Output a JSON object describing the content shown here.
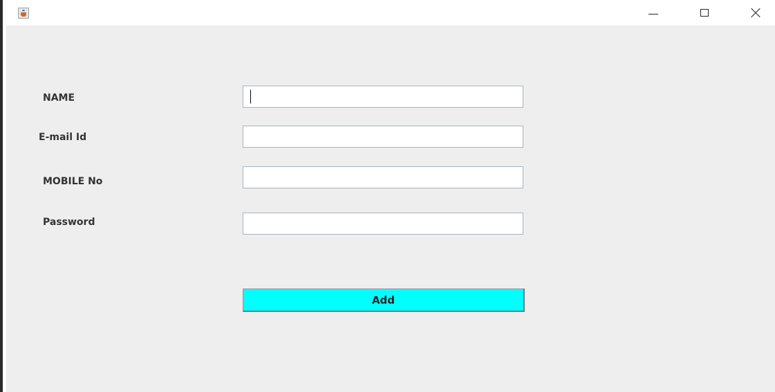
{
  "window": {
    "title": "",
    "app_icon": "java-cup-icon",
    "controls": {
      "minimize": "minimize-icon",
      "maximize": "maximize-icon",
      "close": "close-icon"
    }
  },
  "form": {
    "fields": [
      {
        "label": "NAME",
        "value": "",
        "placeholder": ""
      },
      {
        "label": "E-mail Id",
        "value": "",
        "placeholder": ""
      },
      {
        "label": "MOBILE No",
        "value": "",
        "placeholder": ""
      },
      {
        "label": "Password",
        "value": "",
        "placeholder": ""
      }
    ],
    "add_label": "Add"
  },
  "colors": {
    "add_button_bg": "#00ffff",
    "panel_bg": "#eeeeee",
    "label_text": "#333333"
  }
}
